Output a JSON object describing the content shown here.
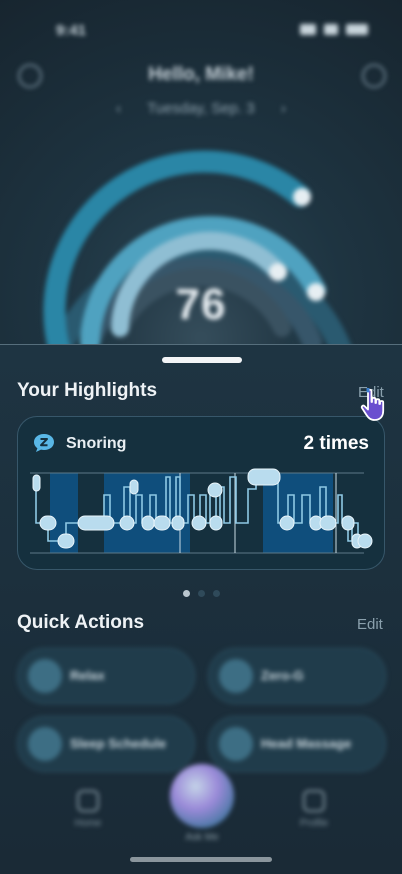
{
  "status_bar": {
    "time": "9:41"
  },
  "header": {
    "greeting": "Hello, Mike!",
    "date": "Tuesday, Sep. 3",
    "prev_arrow": "‹",
    "next_arrow": "›"
  },
  "score": {
    "value": "76"
  },
  "highlights": {
    "title": "Your Highlights",
    "edit_label": "Edit",
    "card": {
      "icon": "snoring-icon",
      "label": "Snoring",
      "value": "2 times"
    },
    "page_count": 3,
    "active_page": 0
  },
  "quick_actions": {
    "title": "Quick Actions",
    "edit_label": "Edit",
    "items": [
      {
        "label": "Relax",
        "icon": "relax-icon"
      },
      {
        "label": "Zero-G",
        "icon": "zero-g-icon"
      },
      {
        "label": "Sleep Schedule",
        "icon": "sleep-schedule-icon"
      },
      {
        "label": "Head Massage",
        "icon": "head-massage-icon"
      }
    ]
  },
  "nav": {
    "left_label": "Home",
    "center_label": "Ask Me",
    "right_label": "Profile"
  },
  "colors": {
    "accent": "#2f8fb0",
    "card_bg": "#15303e",
    "chart_band": "#0f4e7c",
    "chart_pill": "#b9dcee"
  }
}
